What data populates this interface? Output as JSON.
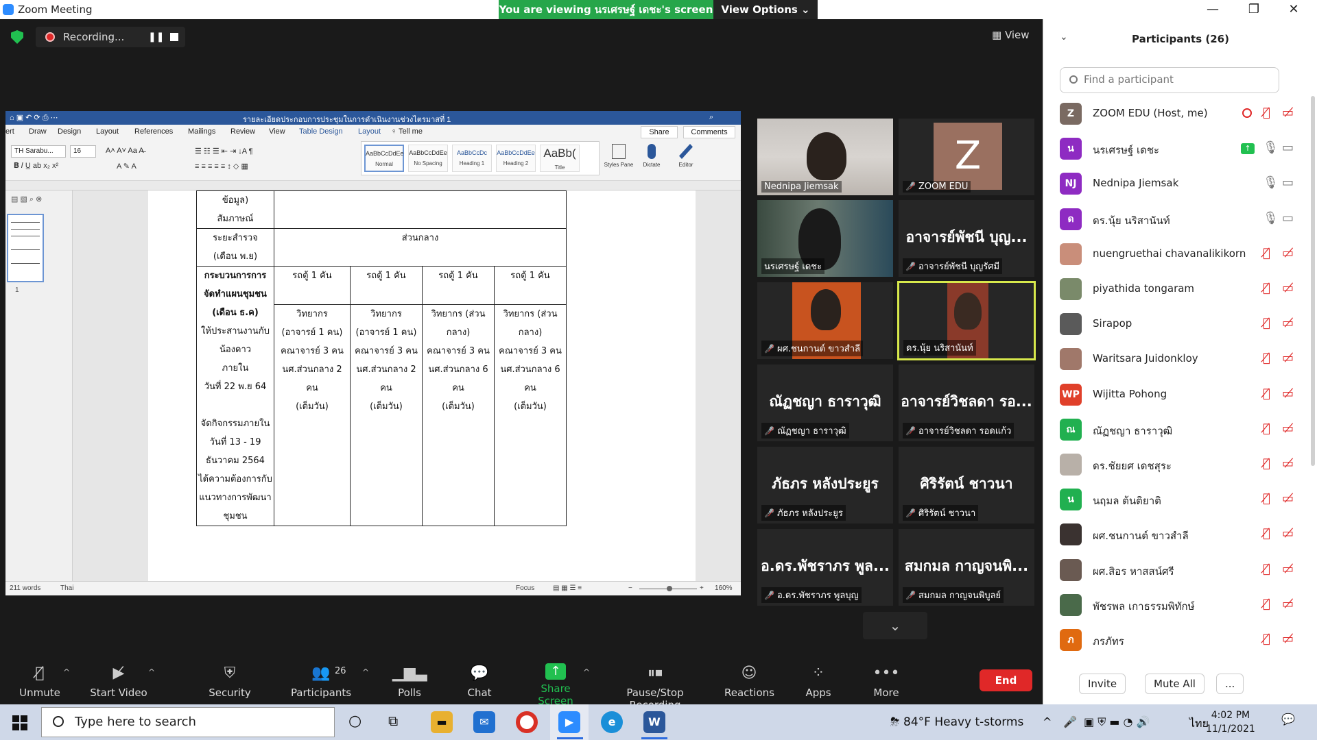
{
  "window": {
    "title": "Zoom Meeting",
    "banner": "You are viewing นรเศรษฐ์ เดชะ's screen",
    "view_options": "View Options ⌄",
    "minimize": "—",
    "restore": "❐",
    "close": "✕"
  },
  "meeting": {
    "recording_label": "Recording...",
    "pause": "❚❚",
    "view_label": "View"
  },
  "word": {
    "doc_title": "รายละเอียดประกอบการประชุมในการดำเนินงานช่วงไตรมาสที่ 1",
    "tabs": [
      "ert",
      "Draw",
      "Design",
      "Layout",
      "References",
      "Mailings",
      "Review",
      "View",
      "Table Design",
      "Layout",
      "♀ Tell me"
    ],
    "share": "Share",
    "comments": "Comments",
    "font": "TH Sarabu...",
    "size": "16",
    "styles": [
      {
        "sample": "AaBbCcDdEe",
        "name": "Normal"
      },
      {
        "sample": "AaBbCcDdEe",
        "name": "No Spacing"
      },
      {
        "sample": "AaBbCcDc",
        "name": "Heading 1"
      },
      {
        "sample": "AaBbCcDdEe",
        "name": "Heading 2"
      },
      {
        "sample": "AaBb(",
        "name": "Title"
      }
    ],
    "tools": [
      "Styles Pane",
      "Dictate",
      "Editor"
    ],
    "page_number": "1",
    "status": {
      "words": "211 words",
      "language": "Thai",
      "focus": "Focus",
      "zoom": "160%"
    },
    "table": {
      "r1c1a": "ข้อมูล)",
      "r1c1b": "สัมภาษณ์",
      "r2c1a": "ระยะสำรวจ",
      "r2c1b": "(เดือน พ.ย)",
      "r2c2": "ส่วนกลาง",
      "r3c1": [
        "กระบวนการการ",
        "จัดทำแผนชุมชน",
        "(เดือน ธ.ค)",
        "ให้ประสานงานกับ",
        "น้องดาว",
        "ภายใน",
        "วันที่ 22 พ.ย 64",
        "",
        "จัดกิจกรรมภายใน",
        "วันที่ 13 - 19",
        "ธันวาคม 2564",
        "ได้ความต้องการกับ",
        "แนวทางการพัฒนา",
        "ชุมชน"
      ],
      "van": "รถตู้ 1 คัน",
      "c2": [
        "วิทยากร",
        "(อาจารย์ 1 คน)",
        "คณาจารย์ 3 คน",
        "นศ.ส่วนกลาง 2 คน",
        "(เต็มวัน)"
      ],
      "c3": [
        "วิทยากร",
        "(อาจารย์ 1 คน)",
        "คณาจารย์ 3 คน",
        "นศ.ส่วนกลาง 2 คน",
        "(เต็มวัน)"
      ],
      "c4": [
        "วิทยากร (ส่วนกลาง)",
        "คณาจารย์ 3 คน",
        "นศ.ส่วนกลาง 6 คน",
        "(เต็มวัน)"
      ],
      "c5": [
        "วิทยากร (ส่วนกลาง)",
        "คณาจารย์ 3 คน",
        "นศ.ส่วนกลาง 6 คน",
        "(เต็มวัน)"
      ]
    }
  },
  "tiles": [
    {
      "label": "Nednipa Jiemsak",
      "center": "",
      "muted": false
    },
    {
      "label": "ZOOM EDU",
      "center": "",
      "muted": true,
      "avatar": "Z"
    },
    {
      "label": "นรเศรษฐ์ เดชะ",
      "center": "",
      "muted": false
    },
    {
      "label": "อาจารย์พัชนี บุญรัศมี",
      "center": "อาจารย์พัชนี บุญ...",
      "muted": true
    },
    {
      "label": "ผศ.ชนกานต์ ขาวสำลี",
      "center": "",
      "muted": true
    },
    {
      "label": "ดร.นุ้ย นริสานันท์",
      "center": "",
      "muted": false
    },
    {
      "label": "ณัฏชญา ธาราวุฒิ",
      "center": "ณัฏชญา ธาราวุฒิ",
      "muted": true
    },
    {
      "label": "อาจารย์วิชลดา รอดแก้ว",
      "center": "อาจารย์วิชลดา รอ...",
      "muted": true
    },
    {
      "label": "ภัธภร หลังประยูร",
      "center": "ภัธภร หลังประยูร",
      "muted": true
    },
    {
      "label": "ศิริรัตน์ ชาวนา",
      "center": "ศิริรัตน์ ชาวนา",
      "muted": true
    },
    {
      "label": "อ.ดร.พัชราภร พูลบุญ",
      "center": "อ.ดร.พัชราภร พูล...",
      "muted": true
    },
    {
      "label": "สมกมล กาญจนพิบูลย์",
      "center": "สมกมล กาญจนพิ...",
      "muted": true
    }
  ],
  "toolbar": {
    "unmute": "Unmute",
    "start_video": "Start Video",
    "security": "Security",
    "participants": "Participants",
    "participants_count": "26",
    "polls": "Polls",
    "chat": "Chat",
    "share_screen": "Share Screen",
    "pause_recording": "Pause/Stop Recording",
    "reactions": "Reactions",
    "apps": "Apps",
    "more": "More",
    "end": "End"
  },
  "panel": {
    "title": "Participants (26)",
    "search_placeholder": "Find a participant",
    "participants": [
      {
        "name": "ZOOM EDU (Host, me)",
        "initial": "Z",
        "color": "#7a6a62",
        "mic": "off",
        "video": "off",
        "recording": true
      },
      {
        "name": "นรเศรษฐ์ เดชะ",
        "initial": "น",
        "color": "#8e2bc2",
        "mic": "on",
        "video": "on",
        "sharing": true
      },
      {
        "name": "Nednipa Jiemsak",
        "initial": "NJ",
        "color": "#8e2bc2",
        "mic": "on",
        "video": "on"
      },
      {
        "name": "ดร.นุ้ย นริสานันท์",
        "initial": "ด",
        "color": "#8e2bc2",
        "mic": "on",
        "video": "on"
      },
      {
        "name": "nuengruethai chavanalikikorn",
        "initial": "",
        "color": "#c98e7a",
        "mic": "off",
        "video": "off"
      },
      {
        "name": "piyathida tongaram",
        "initial": "",
        "color": "#7a8a6a",
        "mic": "off",
        "video": "off"
      },
      {
        "name": "Sirapop",
        "initial": "",
        "color": "#5a5a5a",
        "mic": "off",
        "video": "off"
      },
      {
        "name": "Waritsara Juidonkloy",
        "initial": "",
        "color": "#a0786a",
        "mic": "off",
        "video": "off"
      },
      {
        "name": "Wijitta Pohong",
        "initial": "WP",
        "color": "#e0402a",
        "mic": "off",
        "video": "off"
      },
      {
        "name": "ณัฏชญา ธาราวุฒิ",
        "initial": "ณ",
        "color": "#21b050",
        "mic": "off",
        "video": "off"
      },
      {
        "name": "ดร.ชัยยศ เดชสุระ",
        "initial": "",
        "color": "#b8b0a8",
        "mic": "off",
        "video": "off"
      },
      {
        "name": "นฤมล ต้นติยาติ",
        "initial": "น",
        "color": "#21b050",
        "mic": "off",
        "video": "off"
      },
      {
        "name": "ผศ.ชนกานต์ ขาวสำลี",
        "initial": "",
        "color": "#3a3230",
        "mic": "off",
        "video": "off"
      },
      {
        "name": "ผศ.สิอร หาสสน์ศรี",
        "initial": "",
        "color": "#6a5a52",
        "mic": "off",
        "video": "off"
      },
      {
        "name": "พัชรพล เกาธรรมพิทักษ์",
        "initial": "",
        "color": "#4a6a4a",
        "mic": "off",
        "video": "off"
      },
      {
        "name": "ภรภัทร",
        "initial": "ภ",
        "color": "#e06a10",
        "mic": "off",
        "video": "off"
      }
    ],
    "invite": "Invite",
    "mute_all": "Mute All",
    "more": "..."
  },
  "taskbar": {
    "search_placeholder": "Type here to search",
    "weather": "84°F  Heavy t-storms",
    "lang": "ไทย",
    "time": "4:02 PM",
    "date": "11/1/2021"
  }
}
